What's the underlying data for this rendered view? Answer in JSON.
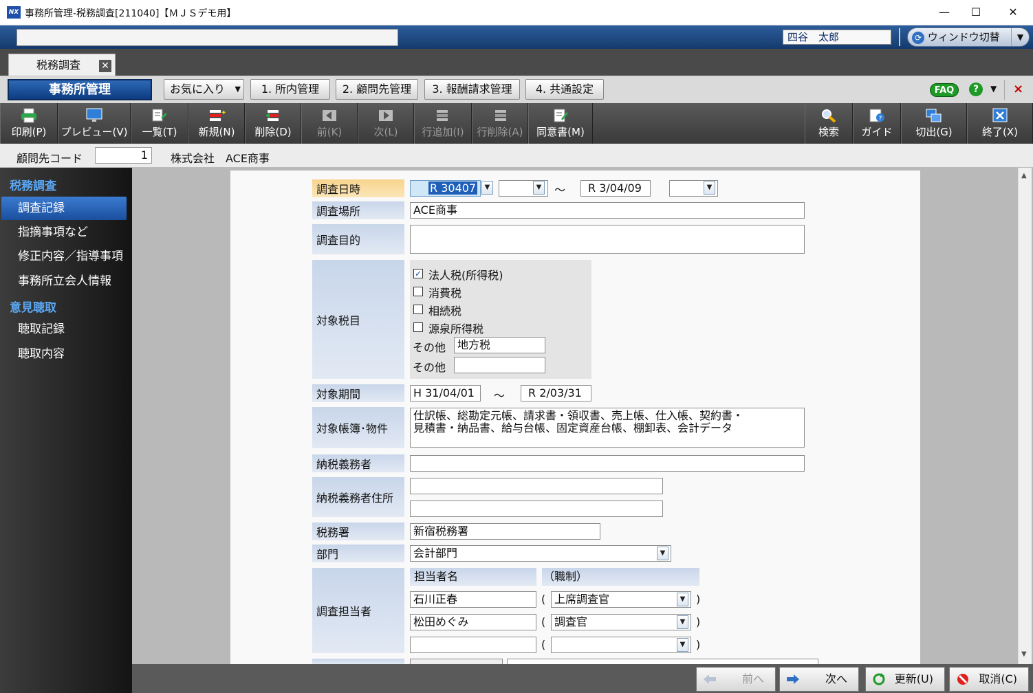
{
  "window": {
    "title": "事務所管理-税務調査[211040]【ＭＪＳデモ用】",
    "logo_text": "NX",
    "minimize": "—",
    "maximize": "☐",
    "close": "✕"
  },
  "topbar": {
    "search_value": "",
    "user_name": "四谷　太郎",
    "window_switch": "ウィンドウ切替"
  },
  "tabs": [
    {
      "label": "税務調査",
      "close": "✕"
    }
  ],
  "menu": {
    "main_label": "事務所管理",
    "favorites": "お気に入り",
    "items": [
      "1. 所内管理",
      "2. 顧問先管理",
      "3. 報酬請求管理",
      "4. 共通設定"
    ],
    "faq": "FAQ",
    "help": "?",
    "close": "×"
  },
  "toolbar": {
    "print": "印刷(P)",
    "preview": "プレビュー(V)",
    "list": "一覧(T)",
    "new": "新規(N)",
    "delete": "削除(D)",
    "prev": "前(K)",
    "next": "次(L)",
    "add_row": "行追加(I)",
    "del_row": "行削除(A)",
    "consent": "同意書(M)",
    "search": "検索",
    "guide": "ガイド",
    "cut": "切出(G)",
    "exit": "終了(X)"
  },
  "client": {
    "label": "顧問先コード",
    "code": "1",
    "name": "株式会社　ACE商事"
  },
  "sidebar": {
    "section1": "税務調査",
    "items1": [
      "調査記録",
      "指摘事項など",
      "修正内容／指導事項",
      "事務所立会人情報"
    ],
    "section2": "意見聴取",
    "items2": [
      "聴取記録",
      "聴取内容"
    ]
  },
  "form": {
    "date_label": "調査日時",
    "date_from": "R  30407",
    "tilde": "～",
    "date_to": "R  3/04/09",
    "place_label": "調査場所",
    "place": "ACE商事",
    "purpose_label": "調査目的",
    "purpose": "",
    "tax_label": "対象税目",
    "taxes": [
      {
        "label": "法人税(所得税)",
        "checked": "✓"
      },
      {
        "label": "消費税",
        "checked": ""
      },
      {
        "label": "相続税",
        "checked": ""
      },
      {
        "label": "源泉所得税",
        "checked": ""
      }
    ],
    "other_label": "その他",
    "other1": "地方税",
    "other2": "",
    "period_label": "対象期間",
    "period_from": "H 31/04/01",
    "period_to": "R  2/03/31",
    "books_label": "対象帳簿･物件",
    "books_line1": "仕訳帳、総勘定元帳、請求書・領収書、売上帳、仕入帳、契約書・",
    "books_line2": "見積書・納品書、給与台帳、固定資産台帳、棚卸表、会計データ",
    "taxpayer_label": "納税義務者",
    "taxpayer": "",
    "taxpayer_addr_label": "納税義務者住所",
    "taxpayer_addr1": "",
    "taxpayer_addr2": "",
    "office_label": "税務署",
    "office": "新宿税務署",
    "dept_label": "部門",
    "dept": "会計部門",
    "staff_label": "調査担当者",
    "staff_name_header": "担当者名",
    "staff_role_header": "（職制）",
    "paren_open": "(",
    "paren_close": ")",
    "staff": [
      {
        "name": "石川正春",
        "role": "上席調査官"
      },
      {
        "name": "松田めぐみ",
        "role": "調査官"
      },
      {
        "name": "",
        "role": ""
      }
    ]
  },
  "bottom": {
    "prev": "前へ",
    "next": "次へ",
    "update": "更新(U)",
    "cancel": "取消(C)"
  }
}
